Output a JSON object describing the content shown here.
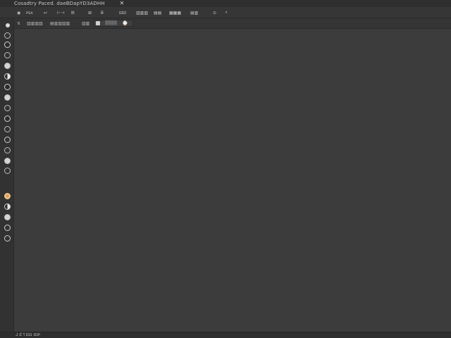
{
  "window": {
    "title": "Cosadtry Paced. daeBDapYD3ADHH",
    "close_glyph": "✕"
  },
  "menubar": {
    "items": [
      {
        "label": "◉"
      },
      {
        "label": "ᴘᴇᴀ"
      },
      {
        "label": "↩"
      },
      {
        "label": "⊢⊣"
      },
      {
        "label": "ⅡⅠ"
      },
      {
        "label": "⊞"
      },
      {
        "label": "ⅲ"
      },
      {
        "label": "⊟⊟"
      },
      {
        "label": "▥▥▥"
      },
      {
        "label": "▤▤"
      },
      {
        "label": "▦▦▦"
      },
      {
        "label": "▤▥"
      },
      {
        "label": "⊙"
      },
      {
        "label": "ᵍ"
      }
    ]
  },
  "secondbar": {
    "items": [
      {
        "label": "↯"
      },
      {
        "label": "▥▥▥▥"
      },
      {
        "label": "▤▥▥▥▥"
      },
      {
        "label": "▥▥"
      }
    ],
    "field": {
      "placeholder": "ᐧ ▒▒▒▒"
    },
    "right_icon": "⌚"
  },
  "statusbar": {
    "text": "⅃ ℭ↿ɪɪɪɪ ɪɪɪᴘ"
  },
  "colors": {
    "background": "#3c3c3c",
    "sidebar": "#323232",
    "titlebar": "#2f2f2f",
    "accent_orange": "#d6a15a"
  },
  "sidebar_tools": [
    "small-dot-icon",
    "ring-icon",
    "dark-dot-icon",
    "ring-icon",
    "filled-dot-icon",
    "half-icon",
    "dark-dot-icon",
    "filled-dot-icon",
    "ring-thin-icon",
    "dark-dot-icon",
    "ring-thin-icon",
    "ring-icon",
    "ring-thin-icon",
    "filled-dot-icon",
    "ring-thin-icon",
    "orange-dot-icon",
    "half-icon",
    "filled-dot-icon",
    "ring-icon",
    "ring-icon"
  ]
}
